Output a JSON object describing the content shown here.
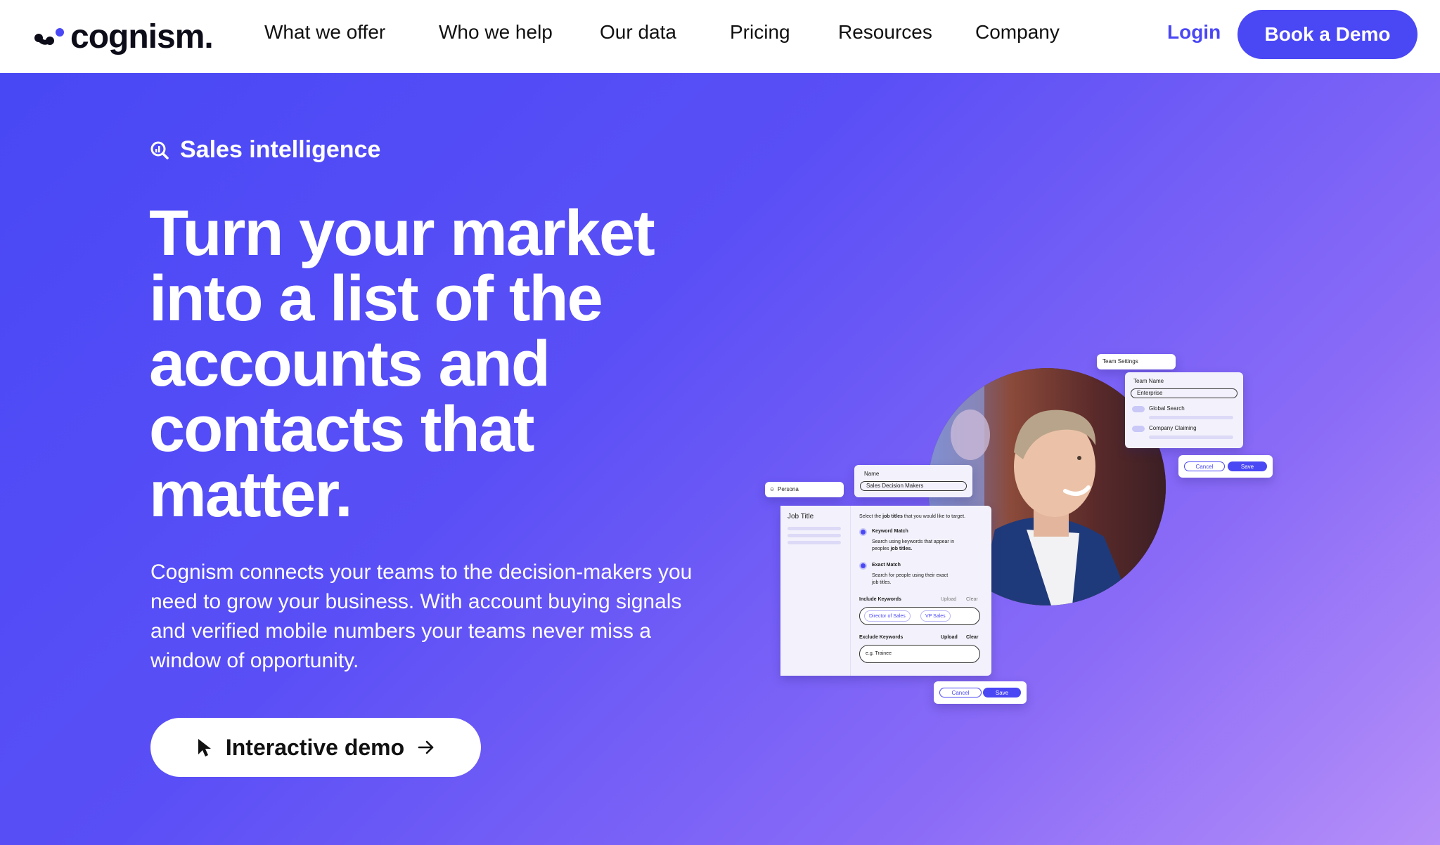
{
  "brand": {
    "name": "cognism.",
    "accent": "#4a47f5",
    "hero_gradient": [
      "#4848f5",
      "#8a6bf7",
      "#b68ff8"
    ]
  },
  "nav": {
    "items": [
      {
        "label": "What we offer"
      },
      {
        "label": "Who we help"
      },
      {
        "label": "Our data"
      },
      {
        "label": "Pricing"
      },
      {
        "label": "Resources"
      },
      {
        "label": "Company"
      }
    ],
    "login": "Login",
    "cta": "Book a Demo"
  },
  "hero": {
    "eyebrow": "Sales intelligence",
    "eyebrow_icon": "search-chart-icon",
    "headline": "Turn your market into a list of the accounts and contacts that matter.",
    "subtext": "Cognism connects your teams to the decision-makers you need to grow your business. With account buying signals and verified mobile numbers your teams never miss a window of opportunity.",
    "demo_button": "Interactive demo",
    "demo_icon": "cursor-icon",
    "demo_arrow_icon": "arrow-right-icon"
  },
  "illustration": {
    "team_settings": {
      "tab": "Team Settings",
      "team_name_label": "Team Name",
      "team_name_value": "Enterprise",
      "toggle_1": "Global Search",
      "toggle_2": "Company Claiming",
      "cancel": "Cancel",
      "save": "Save"
    },
    "persona": {
      "tab": "Persona",
      "name_label": "Name",
      "name_value": "Sales Decision Makers",
      "job_title": "Job Title",
      "instruction_pre": "Select the ",
      "instruction_bold": "job titles",
      "instruction_post": " that you would like to target.",
      "keyword_match": "Keyword Match",
      "keyword_match_desc_1": "Search using keywords that appear in",
      "keyword_match_desc_2_pre": "peoples ",
      "keyword_match_desc_2_bold": "job titles.",
      "exact_match": "Exact Match",
      "exact_match_desc_1": "Search for people using their exact",
      "exact_match_desc_2": "job titles.",
      "include_keywords": "Include Keywords",
      "exclude_keywords": "Exclude Keywords",
      "upload": "Upload",
      "clear": "Clear",
      "include_tags": [
        "Director of Sales",
        "VP Sales"
      ],
      "exclude_placeholder": "e.g. Trainee",
      "cancel": "Cancel",
      "save": "Save"
    }
  }
}
